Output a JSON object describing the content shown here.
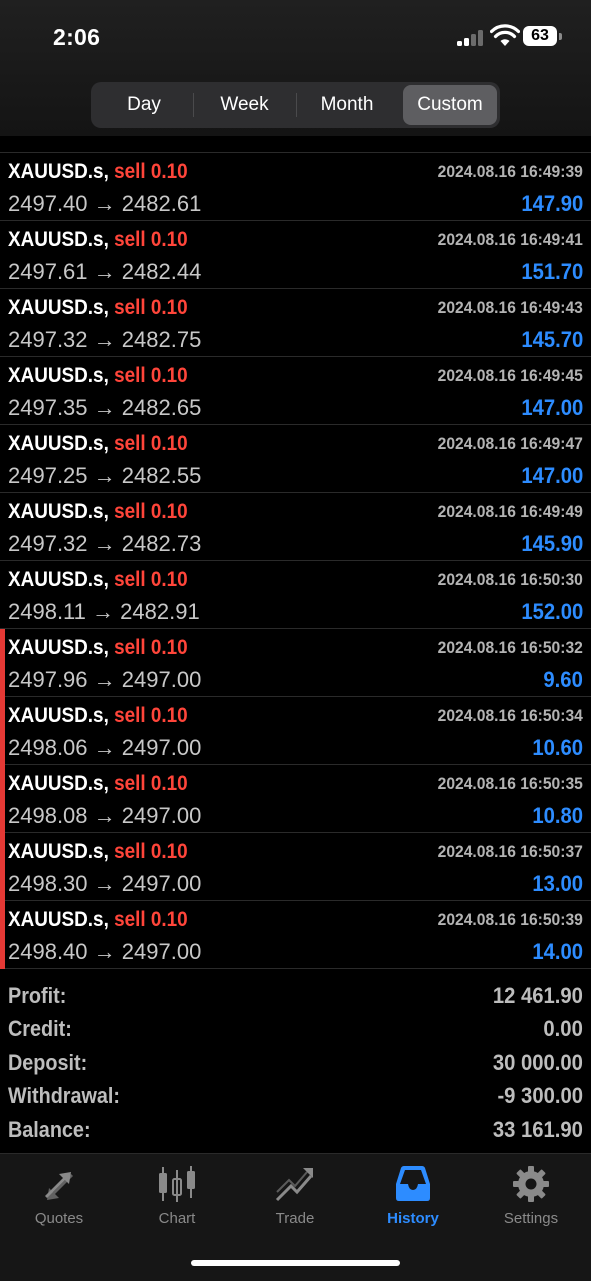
{
  "status_bar": {
    "time": "2:06",
    "battery": "63"
  },
  "period_tabs": [
    {
      "label": "Day",
      "active": false
    },
    {
      "label": "Week",
      "active": false
    },
    {
      "label": "Month",
      "active": false
    },
    {
      "label": "Custom",
      "active": true
    }
  ],
  "arrow": "→",
  "deals": [
    {
      "symbol": "XAUUSD.s,",
      "side": "sell 0.10",
      "time": "2024.08.16 16:49:39",
      "open": "2497.40",
      "close": "2482.61",
      "profit": "147.90",
      "highlight": false
    },
    {
      "symbol": "XAUUSD.s,",
      "side": "sell 0.10",
      "time": "2024.08.16 16:49:41",
      "open": "2497.61",
      "close": "2482.44",
      "profit": "151.70",
      "highlight": false
    },
    {
      "symbol": "XAUUSD.s,",
      "side": "sell 0.10",
      "time": "2024.08.16 16:49:43",
      "open": "2497.32",
      "close": "2482.75",
      "profit": "145.70",
      "highlight": false
    },
    {
      "symbol": "XAUUSD.s,",
      "side": "sell 0.10",
      "time": "2024.08.16 16:49:45",
      "open": "2497.35",
      "close": "2482.65",
      "profit": "147.00",
      "highlight": false
    },
    {
      "symbol": "XAUUSD.s,",
      "side": "sell 0.10",
      "time": "2024.08.16 16:49:47",
      "open": "2497.25",
      "close": "2482.55",
      "profit": "147.00",
      "highlight": false
    },
    {
      "symbol": "XAUUSD.s,",
      "side": "sell 0.10",
      "time": "2024.08.16 16:49:49",
      "open": "2497.32",
      "close": "2482.73",
      "profit": "145.90",
      "highlight": false
    },
    {
      "symbol": "XAUUSD.s,",
      "side": "sell 0.10",
      "time": "2024.08.16 16:50:30",
      "open": "2498.11",
      "close": "2482.91",
      "profit": "152.00",
      "highlight": false
    },
    {
      "symbol": "XAUUSD.s,",
      "side": "sell 0.10",
      "time": "2024.08.16 16:50:32",
      "open": "2497.96",
      "close": "2497.00",
      "profit": "9.60",
      "highlight": true
    },
    {
      "symbol": "XAUUSD.s,",
      "side": "sell 0.10",
      "time": "2024.08.16 16:50:34",
      "open": "2498.06",
      "close": "2497.00",
      "profit": "10.60",
      "highlight": true
    },
    {
      "symbol": "XAUUSD.s,",
      "side": "sell 0.10",
      "time": "2024.08.16 16:50:35",
      "open": "2498.08",
      "close": "2497.00",
      "profit": "10.80",
      "highlight": true
    },
    {
      "symbol": "XAUUSD.s,",
      "side": "sell 0.10",
      "time": "2024.08.16 16:50:37",
      "open": "2498.30",
      "close": "2497.00",
      "profit": "13.00",
      "highlight": true
    },
    {
      "symbol": "XAUUSD.s,",
      "side": "sell 0.10",
      "time": "2024.08.16 16:50:39",
      "open": "2498.40",
      "close": "2497.00",
      "profit": "14.00",
      "highlight": true
    }
  ],
  "summary": [
    {
      "label": "Profit:",
      "value": "12 461.90"
    },
    {
      "label": "Credit:",
      "value": "0.00"
    },
    {
      "label": "Deposit:",
      "value": "30 000.00"
    },
    {
      "label": "Withdrawal:",
      "value": "-9 300.00"
    },
    {
      "label": "Balance:",
      "value": "33 161.90"
    }
  ],
  "tabs": [
    {
      "label": "Quotes",
      "icon": "quotes-icon",
      "active": false
    },
    {
      "label": "Chart",
      "icon": "chart-icon",
      "active": false
    },
    {
      "label": "Trade",
      "icon": "trade-icon",
      "active": false
    },
    {
      "label": "History",
      "icon": "history-icon",
      "active": true
    },
    {
      "label": "Settings",
      "icon": "gear-icon",
      "active": false
    }
  ],
  "colors": {
    "accent": "#2d8cff",
    "sell": "#ff453a",
    "highlight_bar": "#e53935"
  }
}
